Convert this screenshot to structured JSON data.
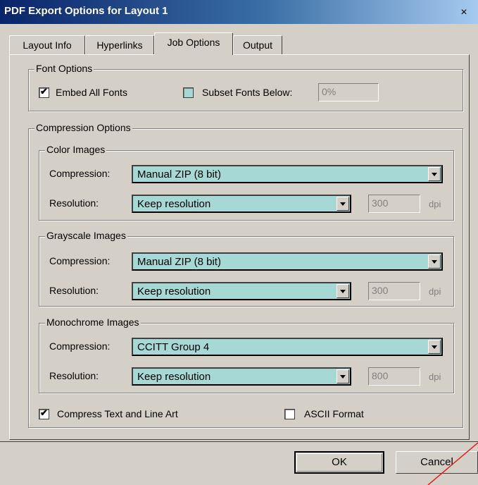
{
  "window": {
    "title": "PDF Export Options for Layout 1",
    "close_label": "×"
  },
  "tabs": [
    {
      "label": "Layout Info"
    },
    {
      "label": "Hyperlinks"
    },
    {
      "label": "Job Options",
      "active": true
    },
    {
      "label": "Output"
    }
  ],
  "font_options": {
    "legend": "Font Options",
    "embed_all_fonts": {
      "label": "Embed All Fonts",
      "checked": true
    },
    "subset_fonts": {
      "label": "Subset Fonts Below:",
      "checked": false,
      "value": "0%"
    }
  },
  "compression_options": {
    "legend": "Compression Options",
    "groups": [
      {
        "legend": "Color Images",
        "compression_label": "Compression:",
        "compression": "Manual ZIP (8 bit)",
        "resolution_label": "Resolution:",
        "resolution": "Keep resolution",
        "dpi_value": "300",
        "dpi_unit": "dpi"
      },
      {
        "legend": "Grayscale Images",
        "compression_label": "Compression:",
        "compression": "Manual ZIP (8 bit)",
        "resolution_label": "Resolution:",
        "resolution": "Keep resolution",
        "dpi_value": "300",
        "dpi_unit": "dpi"
      },
      {
        "legend": "Monochrome Images",
        "compression_label": "Compression:",
        "compression": "CCITT Group 4",
        "resolution_label": "Resolution:",
        "resolution": "Keep resolution",
        "dpi_value": "800",
        "dpi_unit": "dpi"
      }
    ],
    "compress_text": {
      "label": "Compress Text and Line Art",
      "checked": true
    },
    "ascii_format": {
      "label": "ASCII Format",
      "checked": false
    }
  },
  "buttons": {
    "ok": "OK",
    "cancel": "Cancel"
  },
  "colors": {
    "select_bg": "#a6d8d6",
    "dialog_bg": "#d4d0c8",
    "title_start": "#0a246a",
    "title_end": "#a6caf0"
  }
}
